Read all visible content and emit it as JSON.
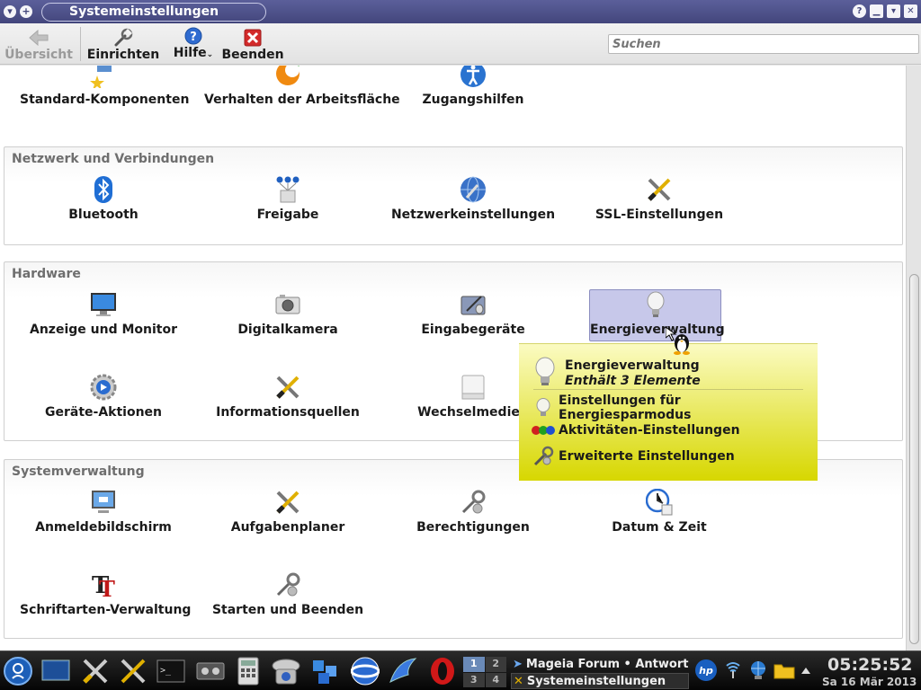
{
  "window": {
    "title": "Systemeinstellungen",
    "titlebar_icons": [
      "chevron-down-icon",
      "plus-icon"
    ],
    "controls": [
      "help-icon",
      "minimize-icon",
      "maximize-icon",
      "close-icon"
    ]
  },
  "toolbar": {
    "overview_label": "Übersicht",
    "configure_label": "Einrichten",
    "help_label": "Hilfe",
    "quit_label": "Beenden",
    "search_placeholder": "Suchen"
  },
  "sections": {
    "top": {
      "items": [
        {
          "label": "Standard-Komponenten",
          "icon": "default-components-icon"
        },
        {
          "label": "Verhalten der Arbeitsfläche",
          "icon": "workspace-behavior-icon"
        },
        {
          "label": "Zugangshilfen",
          "icon": "accessibility-icon"
        }
      ]
    },
    "network": {
      "title": "Netzwerk und Verbindungen",
      "items": [
        {
          "label": "Bluetooth",
          "icon": "bluetooth-icon"
        },
        {
          "label": "Freigabe",
          "icon": "sharing-icon"
        },
        {
          "label": "Netzwerkeinstellungen",
          "icon": "network-settings-icon"
        },
        {
          "label": "SSL-Einstellungen",
          "icon": "ssl-tools-icon"
        }
      ]
    },
    "hardware": {
      "title": "Hardware",
      "items": [
        {
          "label": "Anzeige und Monitor",
          "icon": "monitor-icon"
        },
        {
          "label": "Digitalkamera",
          "icon": "camera-icon"
        },
        {
          "label": "Eingabegeräte",
          "icon": "input-devices-icon"
        },
        {
          "label": "Energieverwaltung",
          "icon": "lightbulb-icon"
        },
        {
          "label": "Geräte-Aktionen",
          "icon": "device-actions-icon"
        },
        {
          "label": "Informationsquellen",
          "icon": "info-sources-icon"
        },
        {
          "label": "Wechselmedien",
          "icon": "removable-media-icon"
        }
      ]
    },
    "system": {
      "title": "Systemverwaltung",
      "items": [
        {
          "label": "Anmeldebildschirm",
          "icon": "login-screen-icon"
        },
        {
          "label": "Aufgabenplaner",
          "icon": "task-scheduler-icon"
        },
        {
          "label": "Berechtigungen",
          "icon": "permissions-icon"
        },
        {
          "label": "Datum & Zeit",
          "icon": "clock-icon"
        },
        {
          "label": "Schriftarten-Verwaltung",
          "icon": "font-manager-icon"
        },
        {
          "label": "Starten und Beenden",
          "icon": "startup-shutdown-icon"
        }
      ]
    }
  },
  "tooltip": {
    "title": "Energieverwaltung",
    "subtitle": "Enthält 3 Elemente",
    "entries": [
      {
        "label": "Einstellungen für Energiesparmodus",
        "icon": "lightbulb-icon"
      },
      {
        "label": "Aktivitäten-Einstellungen",
        "icon": "activities-icon"
      },
      {
        "label": "Erweiterte Einstellungen",
        "icon": "advanced-settings-icon"
      }
    ]
  },
  "taskbar": {
    "launchers": [
      "kde-menu-icon",
      "desktop-icon",
      "settings-tools-icon",
      "configure-tools-icon",
      "terminal-icon",
      "media-icon",
      "calculator-icon",
      "telephone-icon",
      "network-blocks-icon",
      "seamonkey-icon",
      "firefox-icon",
      "opera-icon"
    ],
    "pager": [
      "1",
      "2",
      "3",
      "4"
    ],
    "tasks": [
      {
        "label": "Mageia Forum • Antwort",
        "icon": "firefox-icon"
      },
      {
        "label": "Systemeinstellungen",
        "icon": "settings-tools-icon"
      }
    ],
    "tray": [
      "hp-icon",
      "wireless-icon",
      "network-globe-icon",
      "folder-icon",
      "expand-arrow-icon"
    ],
    "clock_time": "05:25:52",
    "clock_date": "Sa 16 Mär 2013"
  }
}
